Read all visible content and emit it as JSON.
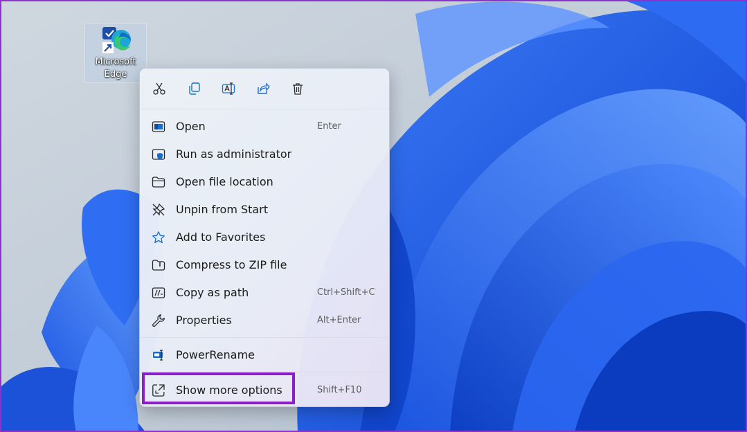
{
  "colors": {
    "accent_highlight": "#8a1fc7",
    "wallpaper_blue": "#1e5be6",
    "wallpaper_bg": "#c9d3dd",
    "icon_blue": "#1565c0"
  },
  "desktop_icon": {
    "label": "Microsoft\nEdge",
    "icon": "microsoft-edge-icon"
  },
  "context_menu": {
    "toolbar": [
      {
        "name": "cut",
        "icon": "scissors-icon"
      },
      {
        "name": "copy",
        "icon": "copy-icon"
      },
      {
        "name": "rename",
        "icon": "rename-icon"
      },
      {
        "name": "share",
        "icon": "share-icon"
      },
      {
        "name": "delete",
        "icon": "trash-icon"
      }
    ],
    "items": [
      {
        "label": "Open",
        "shortcut": "Enter",
        "icon": "open-window-icon"
      },
      {
        "label": "Run as administrator",
        "shortcut": "",
        "icon": "shield-window-icon"
      },
      {
        "label": "Open file location",
        "shortcut": "",
        "icon": "folder-icon"
      },
      {
        "label": "Unpin from Start",
        "shortcut": "",
        "icon": "unpin-icon"
      },
      {
        "label": "Add to Favorites",
        "shortcut": "",
        "icon": "star-icon"
      },
      {
        "label": "Compress to ZIP file",
        "shortcut": "",
        "icon": "zip-folder-icon"
      },
      {
        "label": "Copy as path",
        "shortcut": "Ctrl+Shift+C",
        "icon": "path-icon"
      },
      {
        "label": "Properties",
        "shortcut": "Alt+Enter",
        "icon": "wrench-icon"
      }
    ],
    "extension_item": {
      "label": "PowerRename",
      "shortcut": "",
      "icon": "powerrename-icon"
    },
    "more_options": {
      "label": "Show more options",
      "shortcut": "Shift+F10",
      "icon": "show-more-icon"
    }
  }
}
